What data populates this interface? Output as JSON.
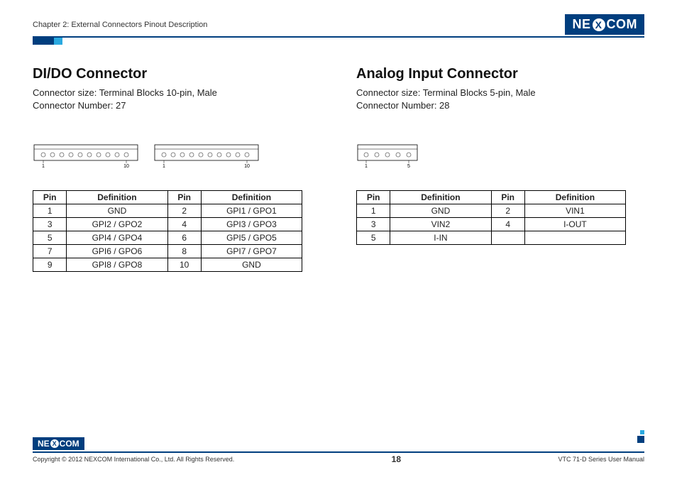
{
  "header": {
    "chapter": "Chapter 2: External Connectors Pinout Description",
    "logo_text_left": "NE",
    "logo_text_x": "X",
    "logo_text_right": "COM"
  },
  "left": {
    "title": "DI/DO Connector",
    "size": "Connector size: Terminal Blocks 10-pin, Male",
    "number": "Connector Number: 27",
    "diagram_labels": {
      "start": "1",
      "end": "10"
    },
    "table": {
      "headers": [
        "Pin",
        "Definition",
        "Pin",
        "Definition"
      ],
      "rows": [
        [
          "1",
          "GND",
          "2",
          "GPI1 / GPO1"
        ],
        [
          "3",
          "GPI2 / GPO2",
          "4",
          "GPI3 / GPO3"
        ],
        [
          "5",
          "GPI4 / GPO4",
          "6",
          "GPI5 / GPO5"
        ],
        [
          "7",
          "GPI6 / GPO6",
          "8",
          "GPI7 / GPO7"
        ],
        [
          "9",
          "GPI8 / GPO8",
          "10",
          "GND"
        ]
      ]
    }
  },
  "right": {
    "title": "Analog Input Connector",
    "size": "Connector size: Terminal Blocks 5-pin, Male",
    "number": "Connector Number: 28",
    "diagram_labels": {
      "start": "1",
      "end": "5"
    },
    "table": {
      "headers": [
        "Pin",
        "Definition",
        "Pin",
        "Definition"
      ],
      "rows": [
        [
          "1",
          "GND",
          "2",
          "VIN1"
        ],
        [
          "3",
          "VIN2",
          "4",
          "I-OUT"
        ],
        [
          "5",
          "I-IN",
          "",
          ""
        ]
      ]
    }
  },
  "footer": {
    "copyright": "Copyright © 2012 NEXCOM International Co., Ltd. All Rights Reserved.",
    "page_number": "18",
    "manual": "VTC 71-D Series User Manual"
  }
}
